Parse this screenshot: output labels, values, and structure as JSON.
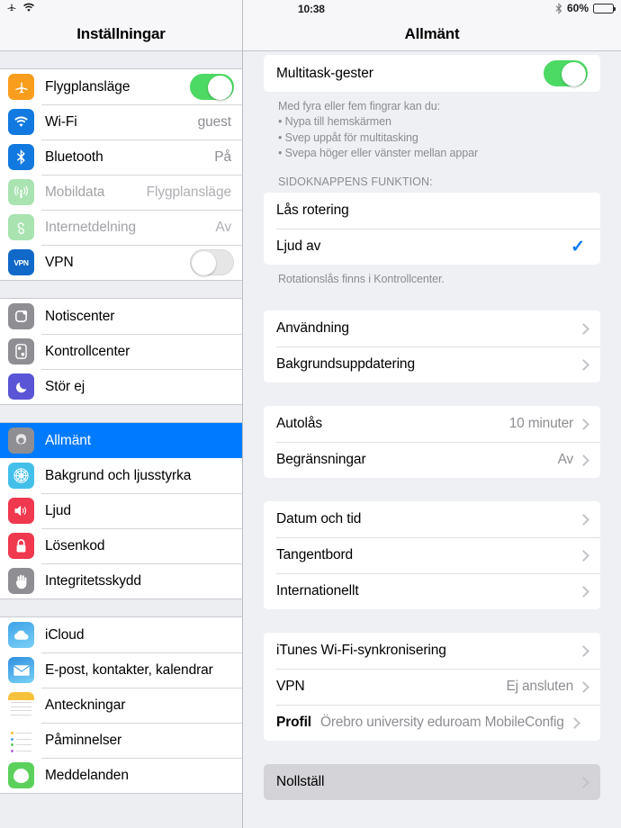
{
  "statusbar": {
    "airplane_icon": "airplane-icon",
    "wifi_icon": "wifi-icon",
    "time": "10:38",
    "bluetooth_icon": "bluetooth-icon",
    "battery_percent": "60%",
    "battery_level": 60
  },
  "sidebar": {
    "title": "Inställningar",
    "groups": [
      {
        "items": [
          {
            "label": "Flygplansläge",
            "icon": "airplane-icon",
            "control": "toggle",
            "toggle_on": true
          },
          {
            "label": "Wi-Fi",
            "icon": "wifi-icon",
            "value": "guest"
          },
          {
            "label": "Bluetooth",
            "icon": "bluetooth-icon",
            "value": "På"
          },
          {
            "label": "Mobildata",
            "icon": "cellular-icon",
            "value": "Flygplansläge",
            "disabled": true
          },
          {
            "label": "Internetdelning",
            "icon": "hotspot-icon",
            "value": "Av",
            "disabled": true
          },
          {
            "label": "VPN",
            "icon": "vpn-icon",
            "control": "toggle",
            "toggle_on": false
          }
        ]
      },
      {
        "items": [
          {
            "label": "Notiscenter",
            "icon": "notification-center-icon"
          },
          {
            "label": "Kontrollcenter",
            "icon": "control-center-icon"
          },
          {
            "label": "Stör ej",
            "icon": "moon-icon"
          }
        ]
      },
      {
        "items": [
          {
            "label": "Allmänt",
            "icon": "gear-icon",
            "selected": true
          },
          {
            "label": "Bakgrund och ljusstyrka",
            "icon": "wallpaper-icon"
          },
          {
            "label": "Ljud",
            "icon": "speaker-icon"
          },
          {
            "label": "Lösenkod",
            "icon": "lock-icon"
          },
          {
            "label": "Integritetsskydd",
            "icon": "hand-icon"
          }
        ]
      },
      {
        "items": [
          {
            "label": "iCloud",
            "icon": "cloud-icon"
          },
          {
            "label": "E-post, kontakter, kalendrar",
            "icon": "mail-icon"
          },
          {
            "label": "Anteckningar",
            "icon": "notes-icon"
          },
          {
            "label": "Påminnelser",
            "icon": "reminders-icon"
          },
          {
            "label": "Meddelanden",
            "icon": "messages-icon"
          }
        ]
      }
    ]
  },
  "main": {
    "title": "Allmänt",
    "multitask": {
      "label": "Multitask-gester",
      "toggle_on": true,
      "footer_intro": "Med fyra eller fem fingrar kan du:",
      "footer_bullets": [
        "• Nypa till hemskärmen",
        "• Svep uppåt för multitasking",
        "• Svepa höger eller vänster mellan appar"
      ]
    },
    "side_switch": {
      "header": "SIDOKNAPPENS FUNKTION:",
      "options": [
        {
          "label": "Lås rotering",
          "checked": false
        },
        {
          "label": "Ljud av",
          "checked": true
        }
      ],
      "footer": "Rotationslås finns i Kontrollcenter."
    },
    "usage_group": [
      {
        "label": "Användning",
        "value": "",
        "chevron": true
      },
      {
        "label": "Bakgrundsuppdatering",
        "value": "",
        "chevron": true
      }
    ],
    "lock_group": [
      {
        "label": "Autolås",
        "value": "10 minuter",
        "chevron": true
      },
      {
        "label": "Begränsningar",
        "value": "Av",
        "chevron": true
      }
    ],
    "datetime_group": [
      {
        "label": "Datum och tid",
        "value": "",
        "chevron": true
      },
      {
        "label": "Tangentbord",
        "value": "",
        "chevron": true
      },
      {
        "label": "Internationellt",
        "value": "",
        "chevron": true
      }
    ],
    "network_group": [
      {
        "label": "iTunes Wi-Fi-synkronisering",
        "value": "",
        "chevron": true
      },
      {
        "label": "VPN",
        "value": "Ej ansluten",
        "chevron": true
      },
      {
        "label": "Profil",
        "value": "Örebro university eduroam MobileConfig",
        "chevron": true,
        "bold_label": true
      }
    ],
    "reset_group": [
      {
        "label": "Nollställ",
        "value": "",
        "chevron": true,
        "pressed": true
      }
    ]
  },
  "colors": {
    "accent_blue": "#007aff",
    "toggle_green": "#4cd964",
    "sidebar_bg": "#eceef2",
    "main_bg": "#eef0f4",
    "muted_text": "#8e8e93"
  }
}
